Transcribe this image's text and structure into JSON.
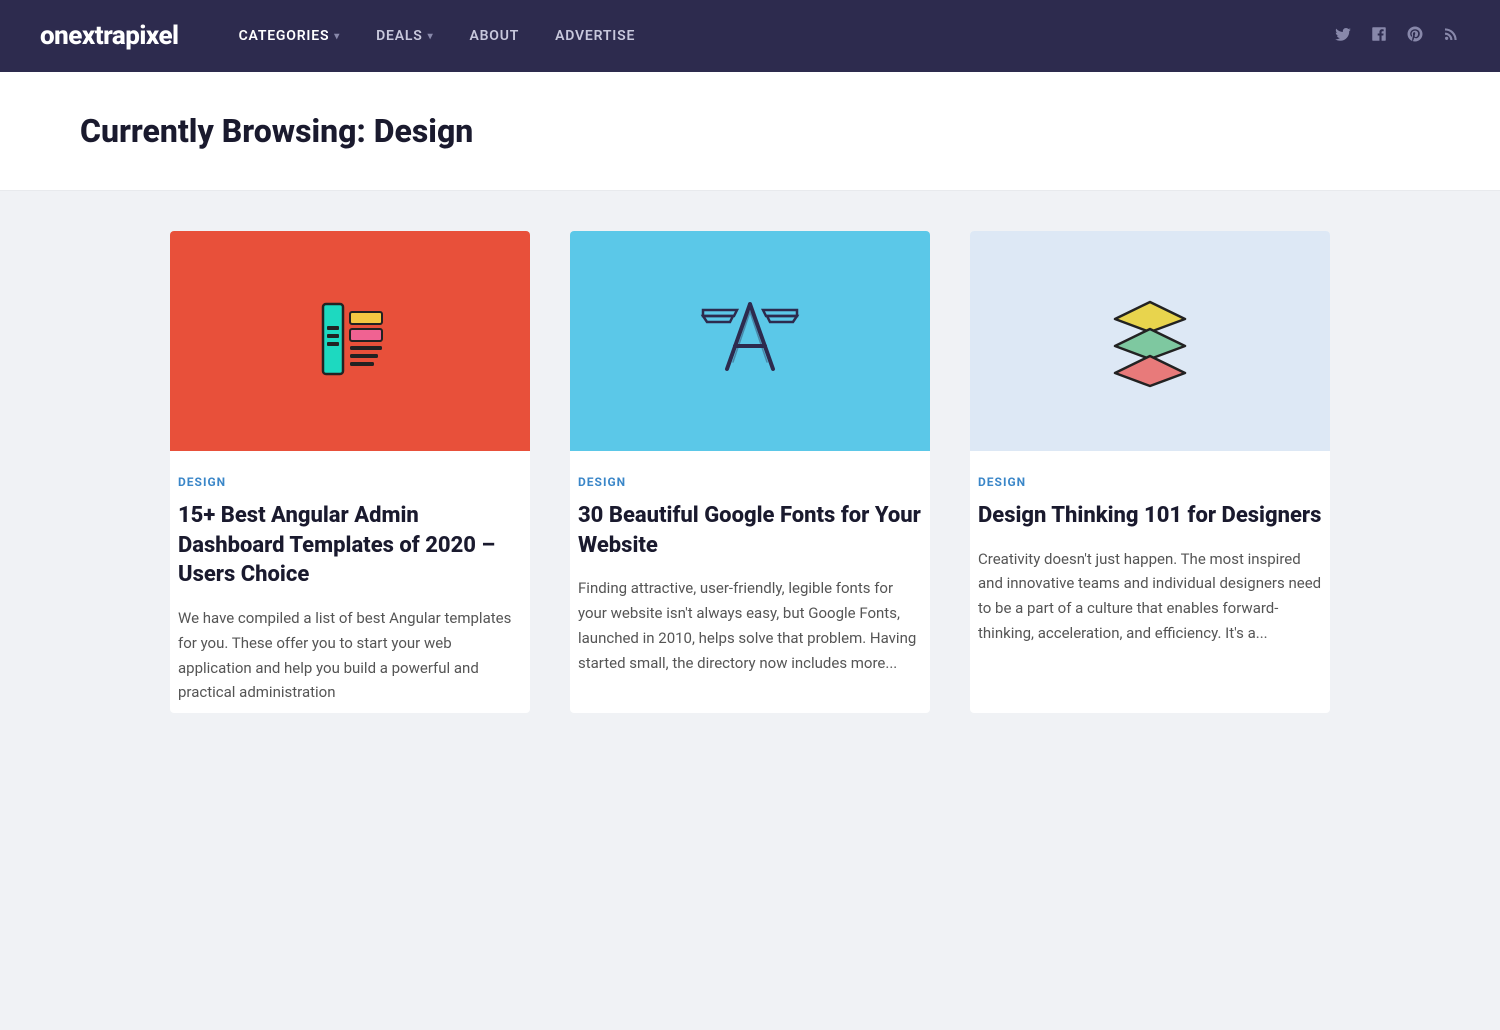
{
  "site": {
    "logo": "onextrapixel"
  },
  "nav": {
    "links": [
      {
        "label": "CATEGORIES",
        "hasDropdown": true,
        "active": true
      },
      {
        "label": "DEALS",
        "hasDropdown": true,
        "active": false
      },
      {
        "label": "ABOUT",
        "hasDropdown": false,
        "active": false
      },
      {
        "label": "ADVERTISE",
        "hasDropdown": false,
        "active": false
      }
    ],
    "social": [
      {
        "name": "twitter",
        "icon": "𝕏"
      },
      {
        "name": "facebook",
        "icon": "f"
      },
      {
        "name": "pinterest",
        "icon": "p"
      },
      {
        "name": "rss",
        "icon": "rss"
      }
    ]
  },
  "hero": {
    "title": "Currently Browsing: Design"
  },
  "cards": [
    {
      "category": "DESIGN",
      "title": "15+ Best Angular Admin Dashboard Templates of 2020 – Users Choice",
      "excerpt": "We have compiled a list of best Angular templates for you. These offer you to start your web application and help you build a powerful and practical administration",
      "image_bg": "red-bg",
      "image_type": "dashboard"
    },
    {
      "category": "DESIGN",
      "title": "30 Beautiful Google Fonts for Your Website",
      "excerpt": "Finding attractive, user-friendly, legible fonts for your website isn't always easy, but Google Fonts, launched in 2010, helps solve that problem. Having started small, the directory now includes more...",
      "image_bg": "blue-bg",
      "image_type": "font"
    },
    {
      "category": "DESIGN",
      "title": "Design Thinking 101 for Designers",
      "excerpt": "Creativity doesn't just happen. The most inspired and innovative teams and individual designers need to be a part of a culture that enables forward-thinking, acceleration, and efficiency. It's a...",
      "image_bg": "light-blue-bg",
      "image_type": "layers"
    }
  ]
}
